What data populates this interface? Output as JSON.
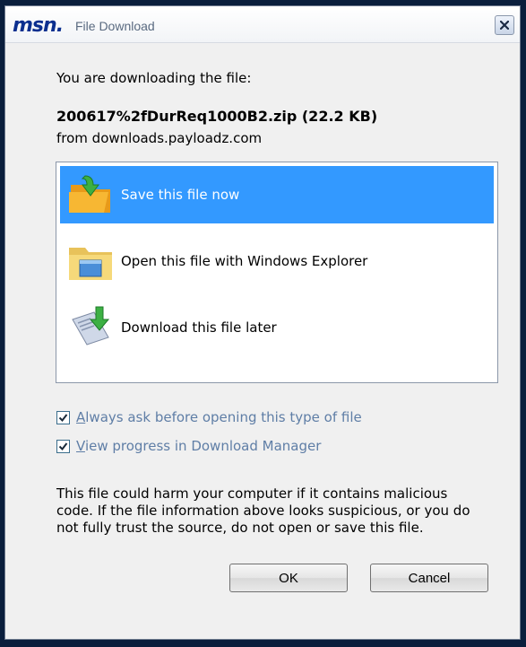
{
  "titlebar": {
    "logo": "msn",
    "logo_dot": ".",
    "title": "File Download",
    "close_icon": "close-x-icon"
  },
  "dialog": {
    "intro": "You are downloading the file:",
    "filename": "200617%2fDurReq1000B2.zip (22.2 KB)",
    "source": "from downloads.payloadz.com"
  },
  "options": [
    {
      "label": "Save this file now",
      "icon": "folder-save-icon",
      "selected": true
    },
    {
      "label": "Open this file with Windows Explorer",
      "icon": "explorer-folder-icon",
      "selected": false
    },
    {
      "label": "Download this file later",
      "icon": "download-later-icon",
      "selected": false
    }
  ],
  "checkboxes": {
    "always_ask_prefix": "A",
    "always_ask_rest": "lways ask before opening this type of file",
    "always_ask_checked": true,
    "view_progress_prefix": "V",
    "view_progress_rest": "iew progress in Download Manager",
    "view_progress_checked": true
  },
  "warning": "This file could harm your computer if it contains malicious code. If the file information above looks suspicious, or you do not fully trust the source, do not open or save this file.",
  "buttons": {
    "ok": "OK",
    "cancel": "Cancel"
  },
  "colors": {
    "selection": "#3399ff",
    "checkbox_label": "#5f7ea6",
    "logo": "#0b2f8f"
  }
}
